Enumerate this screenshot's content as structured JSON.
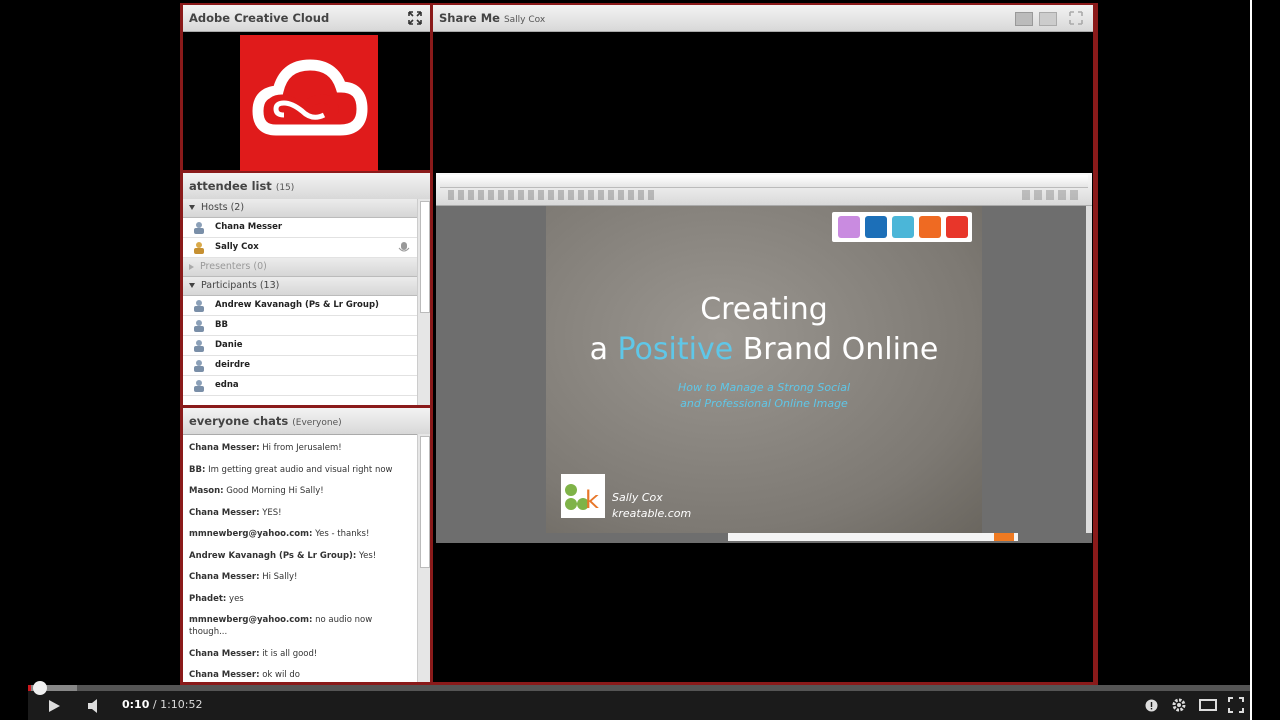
{
  "pods": {
    "logo_pod": {
      "title": "Adobe Creative Cloud"
    },
    "share_pod": {
      "title": "Share Me",
      "presenter": "Sally Cox"
    },
    "attendees": {
      "title": "attendee list",
      "count": "(15)",
      "sections": {
        "hosts": "Hosts (2)",
        "presenters": "Presenters (0)",
        "participants": "Participants (13)"
      },
      "hosts": [
        "Chana Messer",
        "Sally Cox"
      ],
      "participants": [
        "Andrew Kavanagh (Ps & Lr Group)",
        "BB",
        "Danie",
        "deirdre",
        "edna"
      ]
    },
    "chat": {
      "title": "everyone chats",
      "scope": "(Everyone)",
      "messages": [
        {
          "sender": "Chana Messer:",
          "text": "Hi from Jerusalem!"
        },
        {
          "sender": "BB:",
          "text": "Im getting great audio and visual right now"
        },
        {
          "sender": "Mason:",
          "text": "Good Morning Hi Sally!"
        },
        {
          "sender": "Chana Messer:",
          "text": "YES!"
        },
        {
          "sender": "mmnewberg@yahoo.com:",
          "text": "Yes - thanks!"
        },
        {
          "sender": "Andrew Kavanagh (Ps & Lr Group):",
          "text": "Yes!"
        },
        {
          "sender": "Chana Messer:",
          "text": "Hi Sally!"
        },
        {
          "sender": "Phadet:",
          "text": "yes"
        },
        {
          "sender": "mmnewberg@yahoo.com:",
          "text": "no audio now though..."
        },
        {
          "sender": "Chana Messer:",
          "text": "it is all good!"
        },
        {
          "sender": "Chana Messer:",
          "text": "ok wil do"
        }
      ]
    }
  },
  "slide": {
    "line1": "Creating",
    "line2_pre": "a ",
    "line2_hl": "Positive",
    "line2_post": " Brand Online",
    "subtitle1": "How to Manage a Strong Social",
    "subtitle2": "and Professional Online Image",
    "author": "Sally Cox",
    "site": "kreatable.com",
    "logo_text": "k",
    "swatch_colors": [
      "#c98be0",
      "#1c6fb8",
      "#4bb6d8",
      "#ef6a22",
      "#e8362a"
    ]
  },
  "player": {
    "current_time": "0:10",
    "separator": " / ",
    "duration": "1:10:52",
    "progress_fraction": 0.0024,
    "buffered_fraction": 0.04
  }
}
